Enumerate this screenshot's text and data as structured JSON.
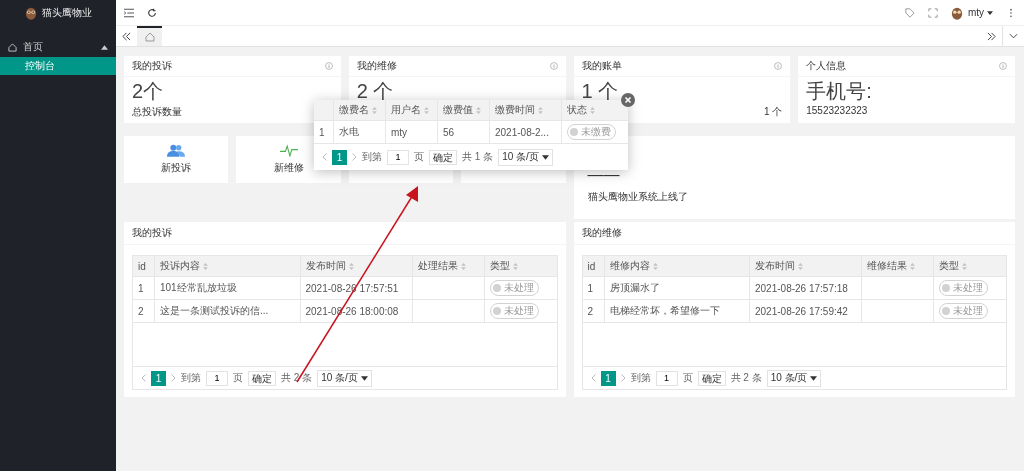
{
  "app": {
    "title": "猫头鹰物业"
  },
  "sidebar": {
    "items": [
      {
        "label": "首页",
        "expanded": true,
        "children": [
          {
            "label": "控制台",
            "selected": true
          }
        ]
      }
    ]
  },
  "header": {
    "user": "mty"
  },
  "stat_cards": [
    {
      "title": "我的投诉",
      "value": "2个",
      "caption": "总投诉数量"
    },
    {
      "title": "我的维修",
      "value": "2 个"
    },
    {
      "title": "我的账单",
      "value": "1 个",
      "caption_right": "1 个"
    },
    {
      "title": "个人信息",
      "value": "手机号:",
      "caption": "15523232323"
    }
  ],
  "shortcuts": [
    {
      "label": "新投诉",
      "kind": "people"
    },
    {
      "label": "新维修",
      "kind": "pulse"
    }
  ],
  "notice": {
    "value": "——",
    "text": "猫头鹰物业系统上线了"
  },
  "panels": [
    {
      "title": "我的投诉",
      "columns": [
        "id",
        "投诉内容",
        "发布时间",
        "处理结果",
        "类型"
      ],
      "rows": [
        {
          "cells": [
            "1",
            "101经常乱放垃圾",
            "2021-08-26 17:57:51",
            ""
          ],
          "status": {
            "label": "未处理",
            "on": false
          }
        },
        {
          "cells": [
            "2",
            "这是一条测试投诉的信...",
            "2021-08-26 18:00:08",
            ""
          ],
          "status": {
            "label": "未处理",
            "on": false
          }
        }
      ],
      "pagination": {
        "current": "1",
        "goto_label": "到第",
        "page_input": "1",
        "page_unit": "页",
        "confirm": "确定",
        "total": "共 2 条",
        "page_size": "10 条/页"
      }
    },
    {
      "title": "我的维修",
      "columns": [
        "id",
        "维修内容",
        "发布时间",
        "维修结果",
        "类型"
      ],
      "rows": [
        {
          "cells": [
            "1",
            "房顶漏水了",
            "2021-08-26 17:57:18",
            ""
          ],
          "status": {
            "label": "未处理",
            "on": false
          }
        },
        {
          "cells": [
            "2",
            "电梯经常坏，希望修一下",
            "2021-08-26 17:59:42",
            ""
          ],
          "status": {
            "label": "未处理",
            "on": false
          }
        }
      ],
      "pagination": {
        "current": "1",
        "goto_label": "到第",
        "page_input": "1",
        "page_unit": "页",
        "confirm": "确定",
        "total": "共 2 条",
        "page_size": "10 条/页"
      }
    }
  ],
  "bill_popup": {
    "columns": [
      "",
      "缴费名",
      "用户名",
      "缴费值",
      "缴费时间",
      "状态"
    ],
    "rows": [
      {
        "cells": [
          "1",
          "水电",
          "mty",
          "56",
          "2021-08-2..."
        ],
        "status": {
          "label": "未缴费",
          "on": false
        }
      }
    ],
    "pagination": {
      "current": "1",
      "goto_label": "到第",
      "page_input": "1",
      "page_unit": "页",
      "confirm": "确定",
      "total": "共 1 条",
      "page_size": "10 条/页"
    }
  }
}
